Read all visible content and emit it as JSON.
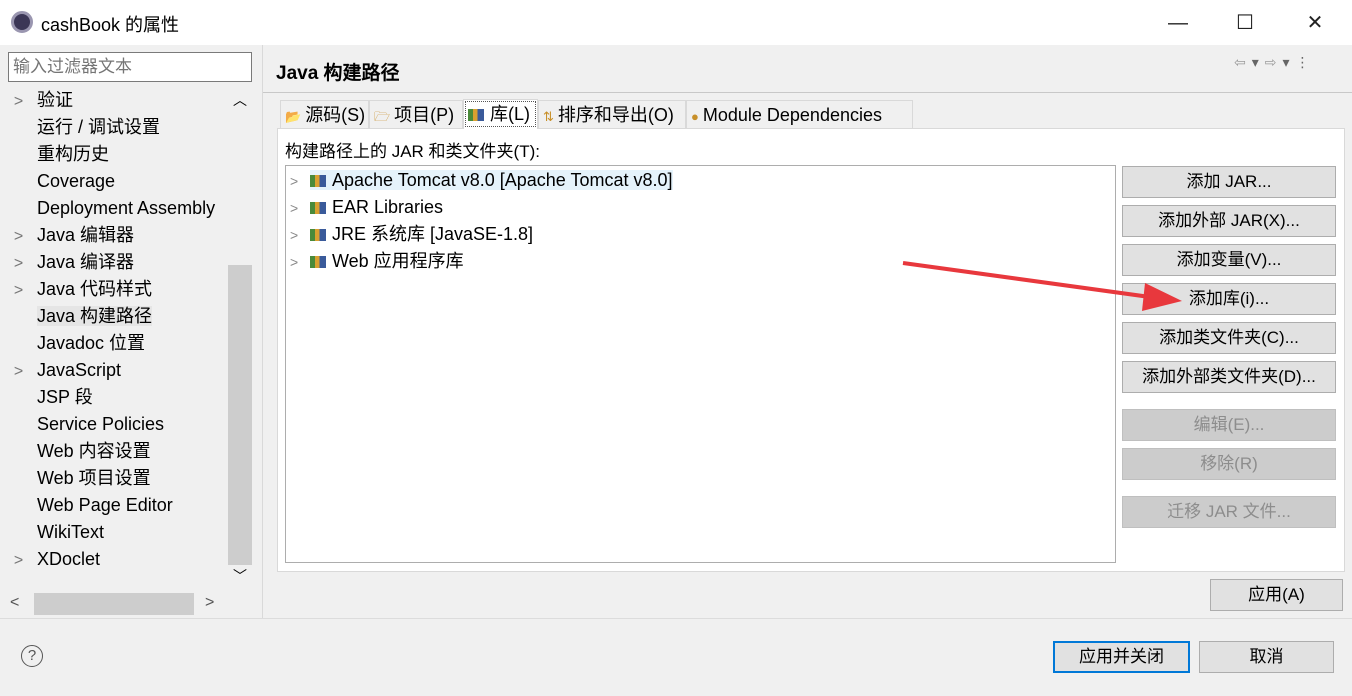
{
  "window": {
    "title": "cashBook 的属性",
    "controls": {
      "minimize": "—",
      "maximize": "☐",
      "close": "✕"
    }
  },
  "sidebar": {
    "filter_placeholder": "输入过滤器文本",
    "items": [
      {
        "label": "验证",
        "expandable": true
      },
      {
        "label": "运行 / 调试设置",
        "expandable": false
      },
      {
        "label": "重构历史",
        "expandable": false
      },
      {
        "label": "Coverage",
        "expandable": false
      },
      {
        "label": "Deployment Assembly",
        "expandable": false
      },
      {
        "label": "Java 编辑器",
        "expandable": true
      },
      {
        "label": "Java 编译器",
        "expandable": true
      },
      {
        "label": "Java 代码样式",
        "expandable": true
      },
      {
        "label": "Java 构建路径",
        "expandable": false,
        "selected": true
      },
      {
        "label": "Javadoc 位置",
        "expandable": false
      },
      {
        "label": "JavaScript",
        "expandable": true
      },
      {
        "label": "JSP 段",
        "expandable": false
      },
      {
        "label": "Service Policies",
        "expandable": false
      },
      {
        "label": "Web 内容设置",
        "expandable": false
      },
      {
        "label": "Web 项目设置",
        "expandable": false
      },
      {
        "label": "Web Page Editor",
        "expandable": false
      },
      {
        "label": "WikiText",
        "expandable": false
      },
      {
        "label": "XDoclet",
        "expandable": true
      }
    ]
  },
  "main": {
    "title": "Java 构建路径",
    "tabs": [
      {
        "label": "源码(S)",
        "icon": "source-folder-icon"
      },
      {
        "label": "项目(P)",
        "icon": "project-folder-icon"
      },
      {
        "label": "库(L)",
        "icon": "library-icon",
        "active": true
      },
      {
        "label": "排序和导出(O)",
        "icon": "order-export-icon"
      },
      {
        "label": "Module Dependencies",
        "icon": "module-icon"
      }
    ],
    "list_label": "构建路径上的 JAR 和类文件夹(T):",
    "libraries": [
      {
        "label": "Apache Tomcat v8.0 [Apache Tomcat v8.0]",
        "selected": true
      },
      {
        "label": "EAR Libraries"
      },
      {
        "label": "JRE 系统库 [JavaSE-1.8]"
      },
      {
        "label": "Web 应用程序库"
      }
    ],
    "buttons": [
      {
        "label": "添加 JAR...",
        "enabled": true
      },
      {
        "label": "添加外部 JAR(X)...",
        "enabled": true
      },
      {
        "label": "添加变量(V)...",
        "enabled": true
      },
      {
        "label": "添加库(i)...",
        "enabled": true
      },
      {
        "label": "添加类文件夹(C)...",
        "enabled": true
      },
      {
        "label": "添加外部类文件夹(D)...",
        "enabled": true
      },
      {
        "label": "编辑(E)...",
        "enabled": false
      },
      {
        "label": "移除(R)",
        "enabled": false
      },
      {
        "label": "迁移 JAR 文件...",
        "enabled": false
      }
    ],
    "apply": "应用(A)"
  },
  "footer": {
    "help": "?",
    "apply_close": "应用并关闭",
    "cancel": "取消"
  },
  "annotation": {
    "arrow_color": "#e8383d"
  }
}
